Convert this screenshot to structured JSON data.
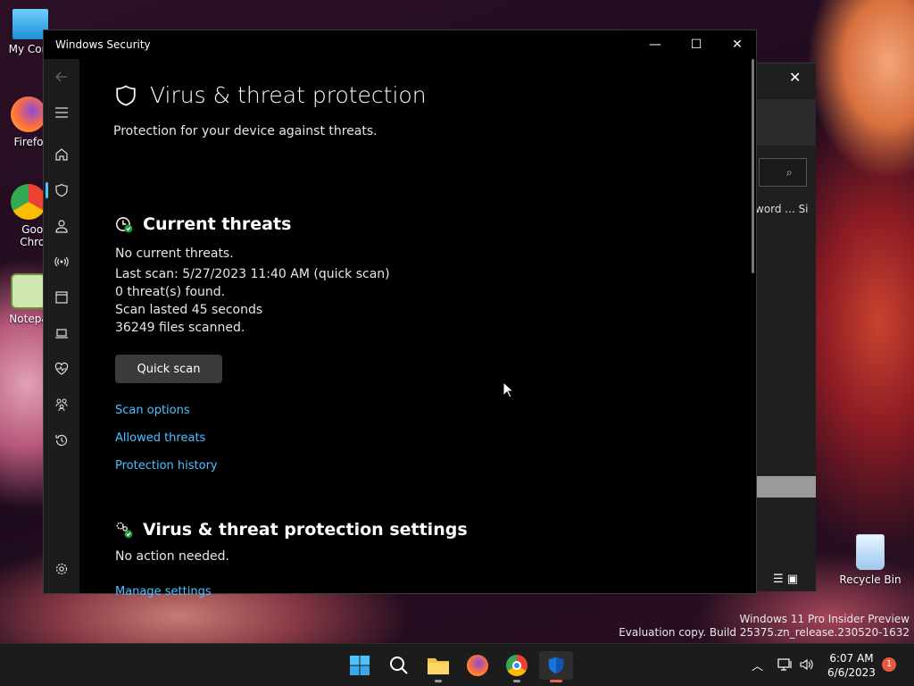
{
  "desktop": {
    "icons": [
      {
        "label": "My Com"
      },
      {
        "label": "Firefo"
      },
      {
        "label": "Goog Chron"
      },
      {
        "label": "Notepa"
      },
      {
        "label": "Recycle Bin"
      }
    ],
    "watermark": {
      "line1": "Windows 11 Pro Insider Preview",
      "line2": "Evaluation copy. Build 25375.zn_release.230520-1632"
    }
  },
  "background_window": {
    "tab_text": "word ...  Si"
  },
  "window": {
    "title": "Windows Security",
    "page_title": "Virus & threat protection",
    "subtitle": "Protection for your device against threats.",
    "current_threats": {
      "heading": "Current threats",
      "status": "No current threats.",
      "last_scan": "Last scan: 5/27/2023 11:40 AM (quick scan)",
      "threats_found": "0 threat(s) found.",
      "scan_duration": "Scan lasted 45 seconds",
      "files_scanned": "36249 files scanned.",
      "quick_scan_label": "Quick scan",
      "links": [
        "Scan options",
        "Allowed threats",
        "Protection history"
      ]
    },
    "settings": {
      "heading": "Virus & threat protection settings",
      "status": "No action needed.",
      "link": "Manage settings"
    },
    "nav_icons": [
      "back-arrow-icon",
      "hamburger-icon",
      "home-icon",
      "shield-icon",
      "person-icon",
      "wifi-signal-icon",
      "app-browser-icon",
      "laptop-icon",
      "heart-pulse-icon",
      "family-icon",
      "history-icon",
      "gear-icon"
    ]
  },
  "taskbar": {
    "time": "6:07 AM",
    "date": "6/6/2023",
    "notification_count": "1",
    "accent": "#4cc2ff"
  }
}
